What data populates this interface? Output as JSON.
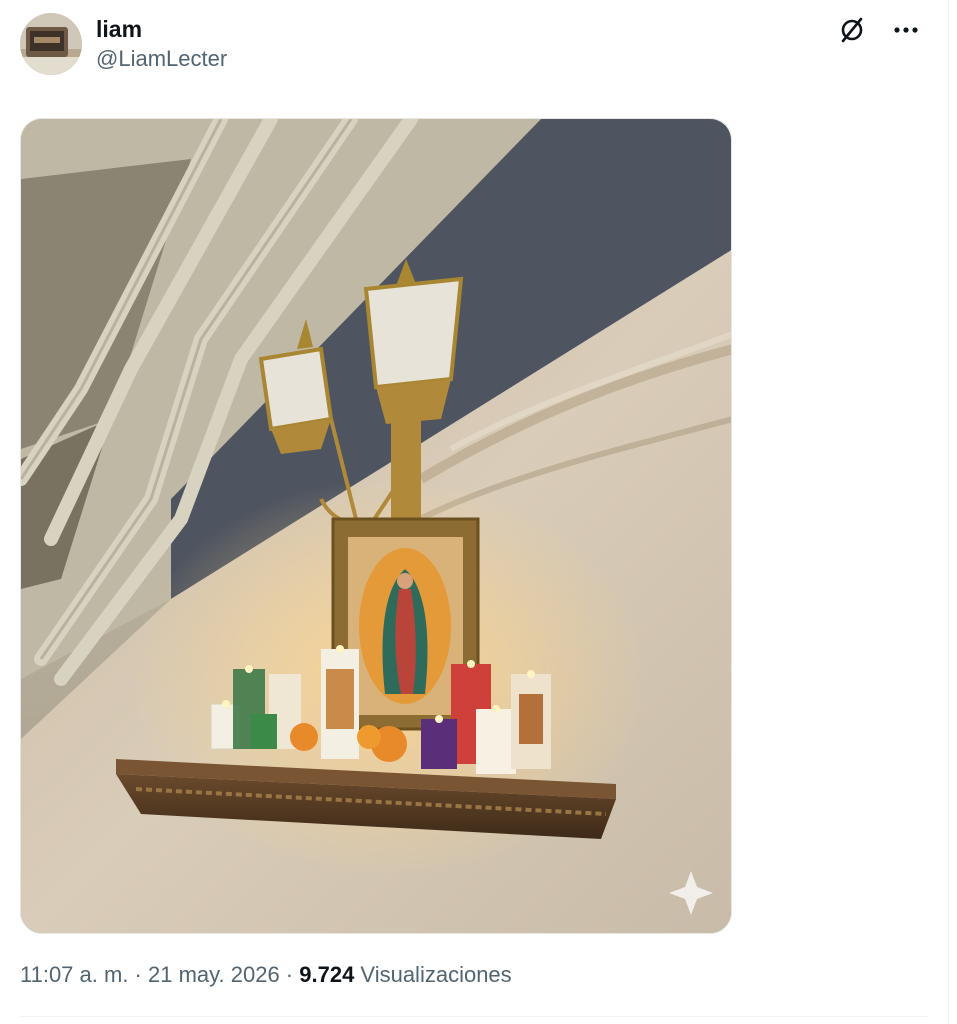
{
  "author": {
    "display_name": "liam",
    "handle": "@LiamLecter"
  },
  "actions": {
    "grok_icon": "grok-icon",
    "more_icon": "more-icon"
  },
  "post": {
    "time": "11:07 a. m.",
    "sep1": " · ",
    "date": "21 may. 2026",
    "sep2": " · ",
    "views_count": "9.724",
    "views_label": " Visualizaciones"
  },
  "colors": {
    "text_primary": "#0f1419",
    "text_secondary": "#536471"
  }
}
